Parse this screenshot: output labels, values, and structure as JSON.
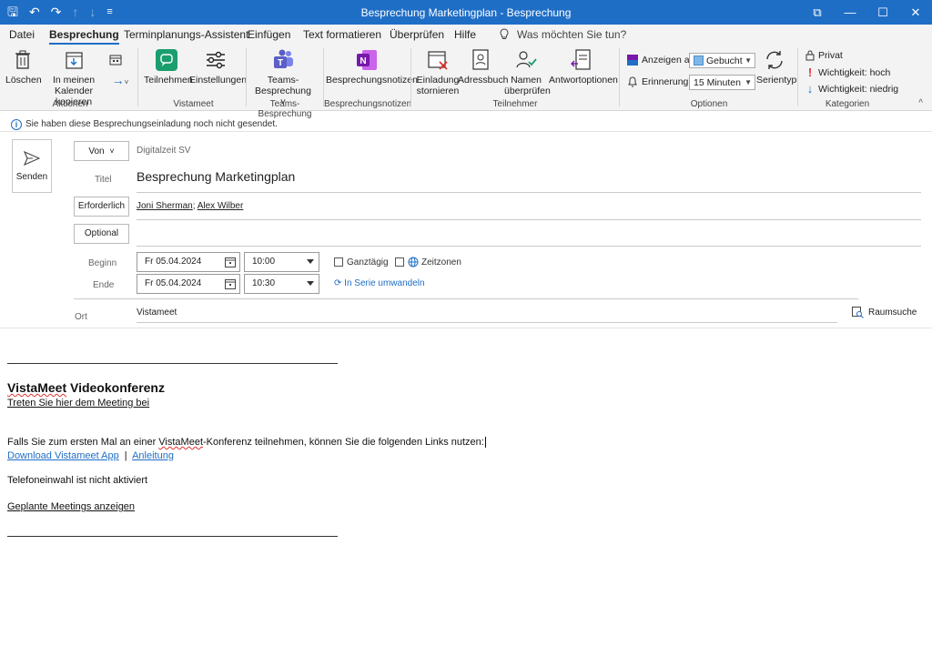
{
  "window": {
    "title": "Besprechung Marketingplan  -  Besprechung",
    "buttons": {
      "restore": "⧉",
      "minimize": "—",
      "maximize": "☐",
      "close": "✕"
    }
  },
  "quick_access": {
    "save": "🖫",
    "undo": "↶",
    "redo": "↷",
    "up": "↑",
    "down": "↓",
    "more": "≡"
  },
  "tabs": [
    "Datei",
    "Besprechung",
    "Terminplanungs-Assistent",
    "Einfügen",
    "Text formatieren",
    "Überprüfen",
    "Hilfe"
  ],
  "tell_me": "Was möchten Sie tun?",
  "ribbon": {
    "groups": {
      "aktionen": "Aktionen",
      "vistameet": "Vistameet",
      "teams": "Teams-Besprechung",
      "notizen": "Besprechungsnotizen",
      "teilnehmer": "Teilnehmer",
      "optionen": "Optionen",
      "kategorien": "Kategorien"
    },
    "buttons": {
      "loeschen": "Löschen",
      "kalender_line1": "In meinen",
      "kalender_line2": "Kalender kopieren",
      "teilnehmen": "Teilnehmen",
      "einstellungen": "Einstellungen",
      "teams_line1": "Teams-",
      "teams_line2": "Besprechung ˅",
      "notizen": "Besprechungsnotizen",
      "einladung_line1": "Einladung",
      "einladung_line2": "stornieren",
      "adressbuch": "Adressbuch",
      "namen_line1": "Namen",
      "namen_line2": "überprüfen",
      "antwort": "Antwortoptionen",
      "serientyp": "Serientyp",
      "privat": "Privat",
      "wichtig_hoch": "Wichtigkeit: hoch",
      "wichtig_niedrig": "Wichtigkeit: niedrig"
    },
    "anzeigen_als_label": "Anzeigen als:",
    "anzeigen_als_value": "Gebucht",
    "erinnerung_label": "Erinnerung:",
    "erinnerung_value": "15 Minuten"
  },
  "info_message": "Sie haben diese Besprechungseinladung noch nicht gesendet.",
  "form": {
    "send_label": "Senden",
    "von_label": "Von",
    "von_value": "Digitalzeit SV",
    "titel_label": "Titel",
    "titel_value": "Besprechung Marketingplan",
    "erforderlich_label": "Erforderlich",
    "attendees": [
      "Joni Sherman",
      "Alex Wilber"
    ],
    "optional_label": "Optional",
    "beginn_label": "Beginn",
    "beginn_date": "Fr 05.04.2024",
    "beginn_time": "10:00",
    "ende_label": "Ende",
    "ende_date": "Fr 05.04.2024",
    "ende_time": "10:30",
    "ganztaegig": "Ganztägig",
    "zeitzonen": "Zeitzonen",
    "serie": "In Serie umwandeln",
    "ort_label": "Ort",
    "ort_value": "Vistameet",
    "raumsuche": "Raumsuche"
  },
  "body": {
    "heading_brand": "VistaMeet",
    "heading_rest": " Videokonferenz",
    "join_link": "Treten Sie hier dem Meeting bei",
    "intro_part1": "Falls Sie zum ersten Mal an einer ",
    "intro_brand": "VistaMeet",
    "intro_part2": "-Konferenz teilnehmen, können Sie die folgenden Links nutzen:",
    "download_link": "Download Vistameet App",
    "separator": "|",
    "anleitung_link": "Anleitung",
    "phone": "Telefoneinwahl ist nicht aktiviert",
    "scheduled_link": "Geplante Meetings anzeigen"
  },
  "colors": {
    "accent": "#1f6ec6",
    "teams": "#5b5fc7",
    "onenote": "#7719aa",
    "vistameet": "#1a9e6e",
    "busy": "#7fb8e8"
  }
}
